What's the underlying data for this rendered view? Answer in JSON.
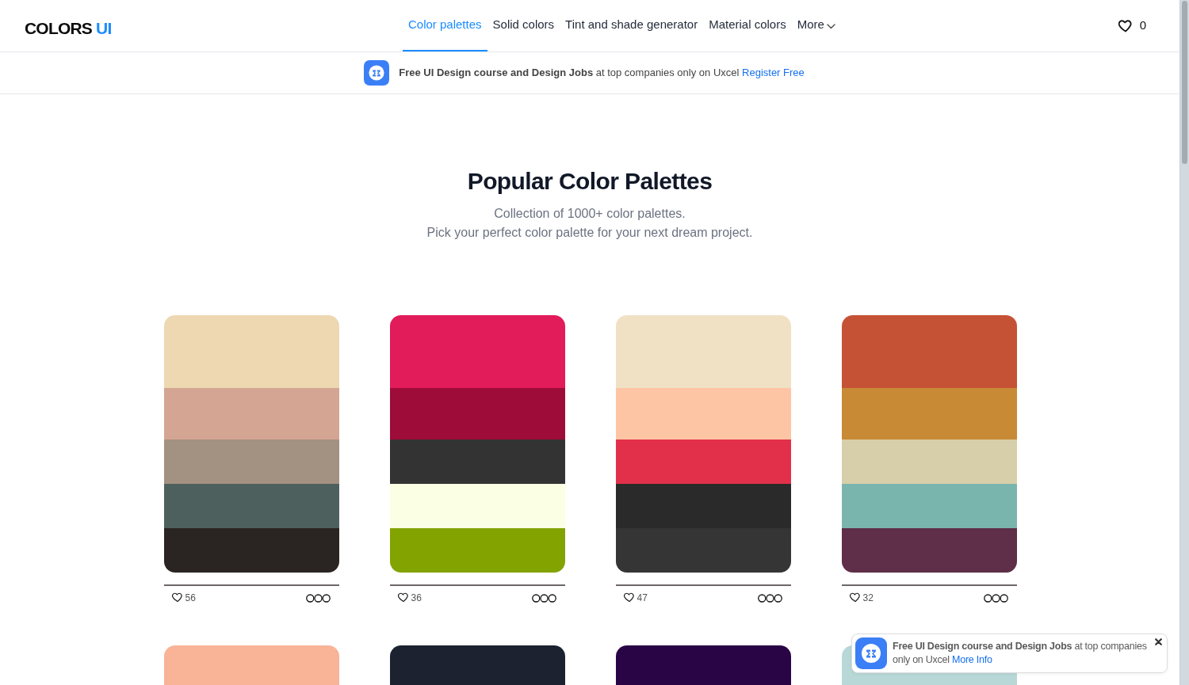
{
  "navbar": {
    "logo": {
      "text": "COLORS",
      "accent": "UI"
    },
    "items": [
      {
        "label": "Color palettes",
        "selected": true,
        "dropdown": false
      },
      {
        "label": "Solid colors",
        "selected": false,
        "dropdown": false
      },
      {
        "label": "Tint and shade generator",
        "selected": false,
        "dropdown": false
      },
      {
        "label": "Material colors",
        "selected": false,
        "dropdown": false
      },
      {
        "label": "More",
        "selected": false,
        "dropdown": true
      }
    ],
    "favorites_count": "0"
  },
  "promo_banner": {
    "text": "**Free UI Design course and Design Jobs** at top companies only on Uxcel",
    "link": "Register Free"
  },
  "hero": {
    "title": "Popular Color Palettes",
    "subtitle": [
      "Collection of 1000+ color palettes.",
      "Pick your perfect color palette for your next dream project."
    ]
  },
  "palettes": [
    {
      "swatches": [
        {
          "color": "#edd8b2"
        },
        {
          "color": "#d4a592"
        },
        {
          "color": "#a39181"
        },
        {
          "color": "#4e605e"
        },
        {
          "color": "#2a2422"
        }
      ],
      "likes": "56"
    },
    {
      "swatches": [
        {
          "color": "#e21b5a"
        },
        {
          "color": "#9e0c39"
        },
        {
          "color": "#333333"
        },
        {
          "color": "#fbffe3"
        },
        {
          "color": "#83a300"
        }
      ],
      "likes": "36"
    },
    {
      "swatches": [
        {
          "color": "#f0e1c5"
        },
        {
          "color": "#fec5a5"
        },
        {
          "color": "#e3304a"
        },
        {
          "color": "#2a2a2a"
        },
        {
          "color": "#353535"
        }
      ],
      "likes": "47"
    },
    {
      "swatches": [
        {
          "color": "#c65235"
        },
        {
          "color": "#c88a34"
        },
        {
          "color": "#d6cfaa"
        },
        {
          "color": "#7ab5ad"
        },
        {
          "color": "#5f2e48"
        }
      ],
      "likes": "32"
    },
    {
      "swatches": [
        {
          "color": "#f9b397"
        }
      ]
    },
    {
      "swatches": [
        {
          "color": "#1c2230"
        }
      ]
    },
    {
      "swatches": [
        {
          "color": "#2a0546"
        }
      ]
    },
    {
      "swatches": [
        {
          "color": "#b8d8d8"
        }
      ]
    }
  ],
  "toast": {
    "text": "**Free UI Design course and Design Jobs** at top companies only on Uxcel",
    "link": "More Info"
  }
}
